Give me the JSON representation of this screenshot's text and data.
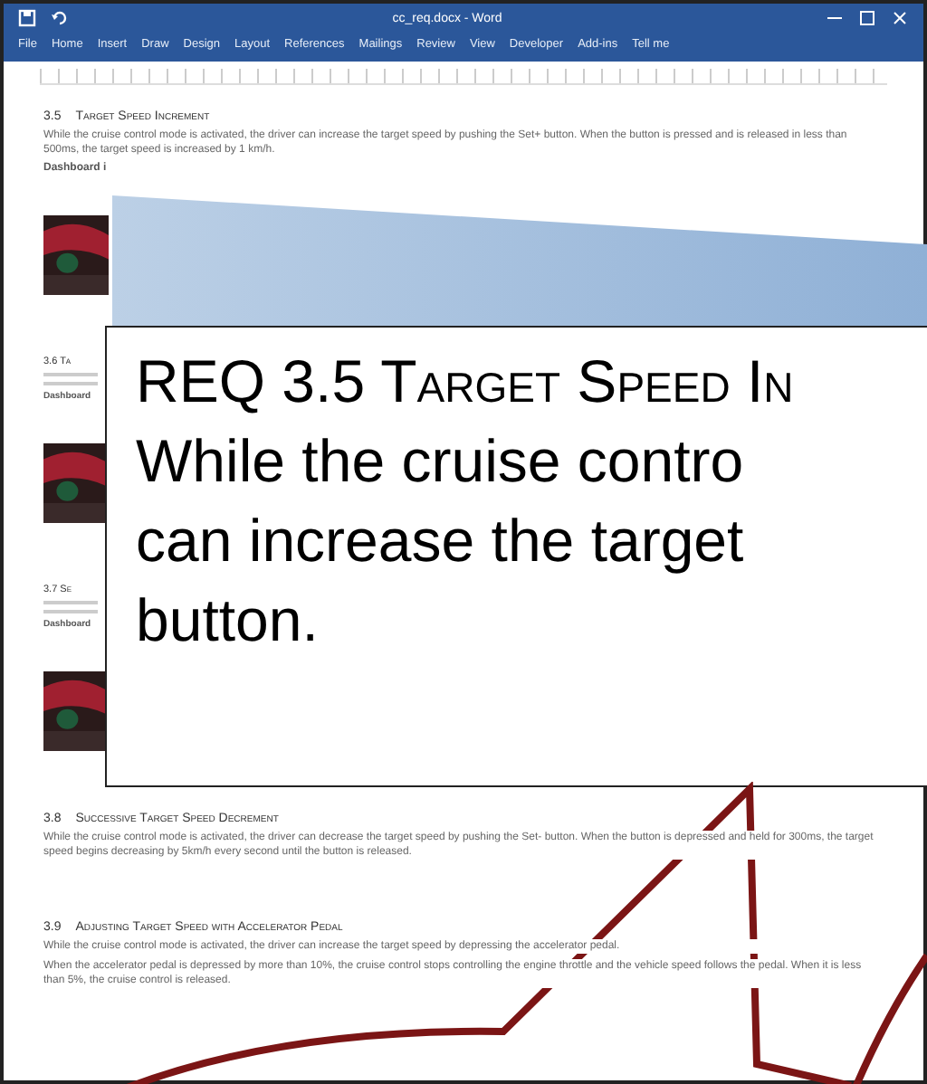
{
  "window": {
    "title": "cc_req.docx - Word"
  },
  "ribbon_tabs": [
    {
      "label": "File",
      "selected": false
    },
    {
      "label": "Home",
      "selected": false
    },
    {
      "label": "Insert",
      "selected": false
    },
    {
      "label": "Draw",
      "selected": false
    },
    {
      "label": "Design",
      "selected": false
    },
    {
      "label": "Layout",
      "selected": false
    },
    {
      "label": "References",
      "selected": false
    },
    {
      "label": "Mailings",
      "selected": false
    },
    {
      "label": "Review",
      "selected": false
    },
    {
      "label": "View",
      "selected": false
    },
    {
      "label": "Developer",
      "selected": false
    },
    {
      "label": "Add-ins",
      "selected": false
    },
    {
      "label": "Tell me",
      "selected": false
    }
  ],
  "document": {
    "sections": [
      {
        "kind": "full",
        "number": "3.5",
        "heading": "Target Speed Increment",
        "body": [
          "While the cruise control mode is activated, the driver can increase the target speed by pushing the Set+ button.  When the button is pressed and is released in less than 500ms, the target speed is increased by 1 km/h."
        ],
        "label": "Dashboard i",
        "picture": true
      },
      {
        "kind": "clipped",
        "heading": "3.6  Ta",
        "label": "Dashboard",
        "picture": true
      },
      {
        "kind": "clipped",
        "heading": "3.7  Se",
        "label": "Dashboard",
        "picture": true
      },
      {
        "kind": "full",
        "number": "3.8",
        "heading": "Successive Target Speed Decrement",
        "body": [
          "While the cruise control mode is activated, the driver can decrease the target speed by pushing the Set- button. When the button is depressed and held for 300ms, the target speed begins decreasing by 5km/h every second until the button is released."
        ],
        "picture": false
      },
      {
        "kind": "full",
        "number": "3.9",
        "heading": "Adjusting Target Speed with Accelerator Pedal",
        "body": [
          "While the cruise control mode is activated, the driver can increase the target speed by depressing the accelerator pedal.",
          "When the accelerator pedal is depressed by more than 10%, the cruise control stops controlling the engine throttle and the vehicle speed follows the pedal. When it is less than 5%, the cruise control is released."
        ],
        "picture": false
      }
    ]
  },
  "callout": {
    "heading": "REQ 3.5 Target Speed In",
    "lines": [
      "While the cruise contro",
      "can increase the target",
      "button."
    ]
  }
}
